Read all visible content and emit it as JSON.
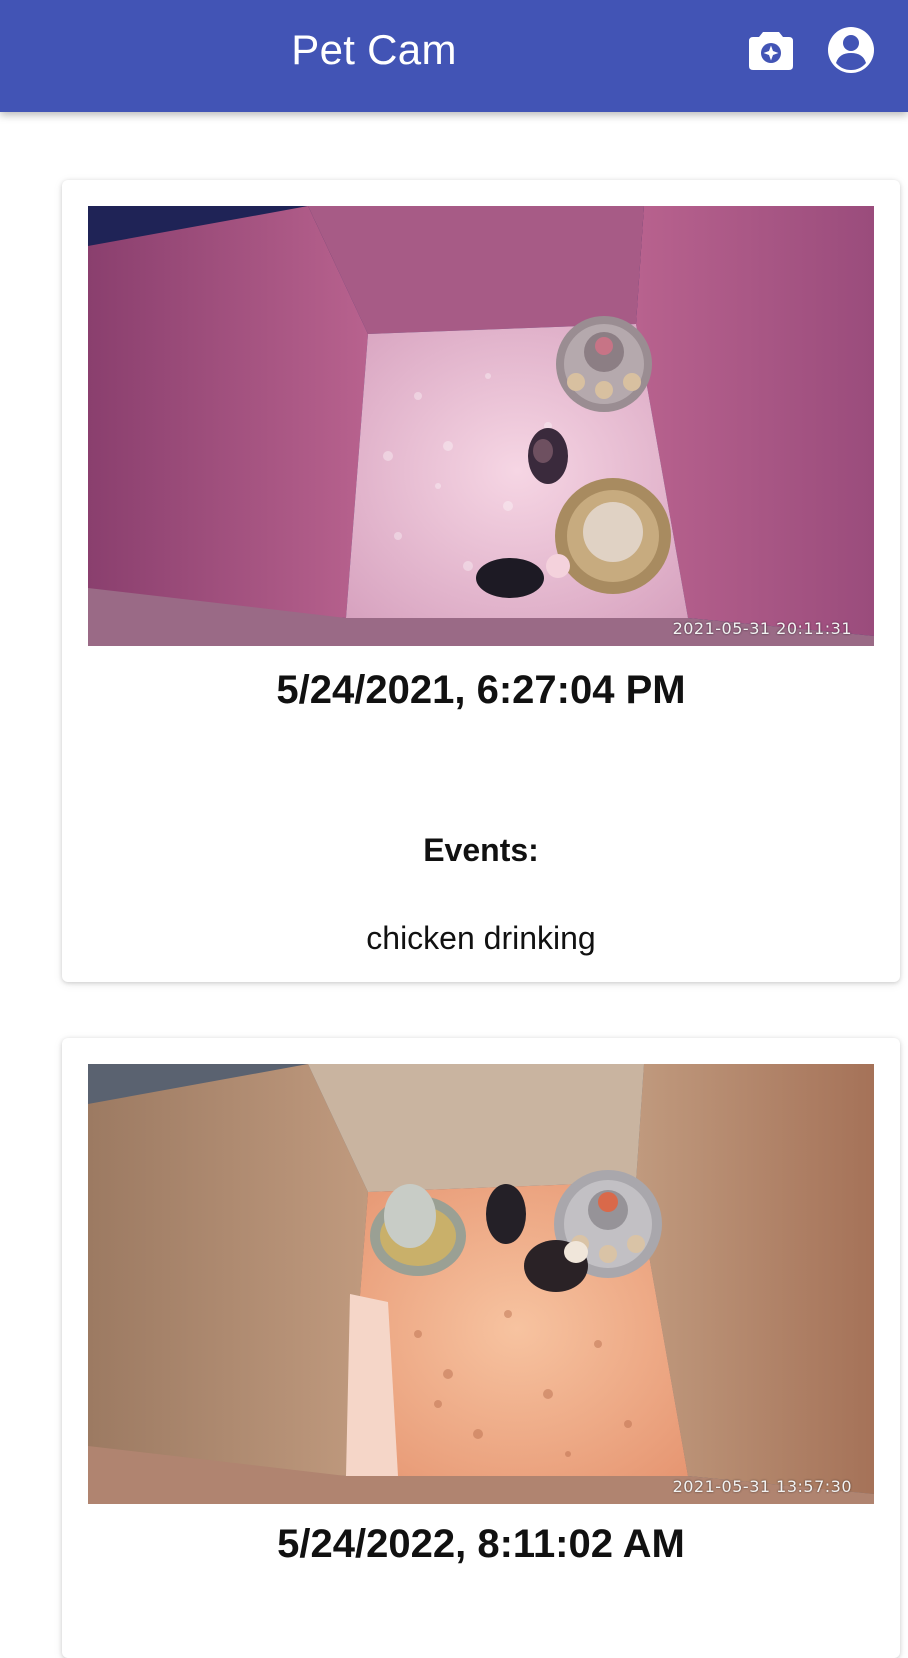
{
  "app": {
    "title": "Pet Cam",
    "accent_color": "#4254b5"
  },
  "toolbar": {
    "actions": [
      {
        "icon": "add-photo-camera-icon"
      },
      {
        "icon": "account-circle-icon"
      }
    ]
  },
  "feed": {
    "items": [
      {
        "image_timestamp": "2021-05-31 20:11:31",
        "date": "5/24/2021, 6:27:04 PM",
        "events_heading": "Events:",
        "events": [
          "chicken drinking"
        ]
      },
      {
        "image_timestamp": "2021-05-31 13:57:30",
        "date": "5/24/2022, 8:11:02 AM"
      }
    ]
  }
}
